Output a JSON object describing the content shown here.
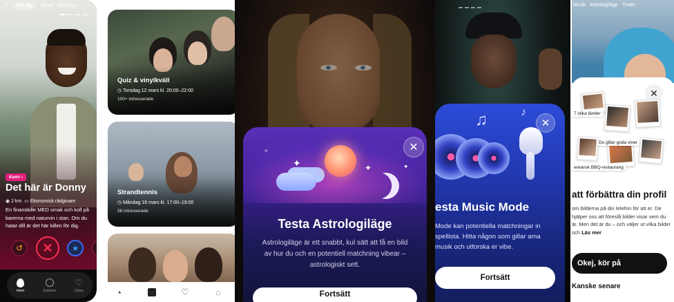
{
  "screen1": {
    "tabs": [
      "För dig",
      "Musik",
      "Astrolog"
    ],
    "badge": "Kemi",
    "name": "Det här är Donny",
    "distance": "2 km",
    "job": "Ekonomisk rådgivare",
    "bio": "En finanskille MED smak och koll på barerna med naturvin i stan. Om du hatar dill är det här killen för dig.",
    "nav": [
      {
        "label": "Hem",
        "icon": "flame-icon"
      },
      {
        "label": "Explore",
        "icon": "compass-icon"
      },
      {
        "label": "Likes",
        "icon": "heart-icon"
      }
    ]
  },
  "screen2": {
    "events": [
      {
        "title": "Quiz & vinylkväll",
        "date": "Torsdag 12 mars kl. 20:00–22:00",
        "interested": "100+ intresserade"
      },
      {
        "title": "Strandtennis",
        "date": "Måndag 16 mars kl. 17:00–19:00",
        "interested": "56 intresserade"
      }
    ]
  },
  "screen3": {
    "title": "Testa Astrologiläge",
    "description": "Astrologiläge är ett snabbt, kul sätt att få en bild av hur du och en potentiell matchning vibear – astrologiskt sett.",
    "cta": "Fortsätt"
  },
  "screen4": {
    "title": "esta Music Mode",
    "description": "Mode kan potentiella matchningar in spellista. Hitta någon som gillar ama musik och utforska er vibe.",
    "cta": "Fortsätt"
  },
  "screen5": {
    "tabs": [
      "Musik",
      "Astrologiläge",
      "Tinder"
    ],
    "tags": [
      "7 olika länder",
      "Du gillar goda viner",
      "ereansk BBQ-restaurang"
    ],
    "title": "att förbättra din profil",
    "description": "om bilderna på din telefon för att er. De hjälper oss att föreslå bilder visar vem du är. Men det är du – och väljer ut vilka bilder och ",
    "read_more": "Läs mer",
    "cta": "Okej, kör på",
    "later": "Kanske senare"
  }
}
